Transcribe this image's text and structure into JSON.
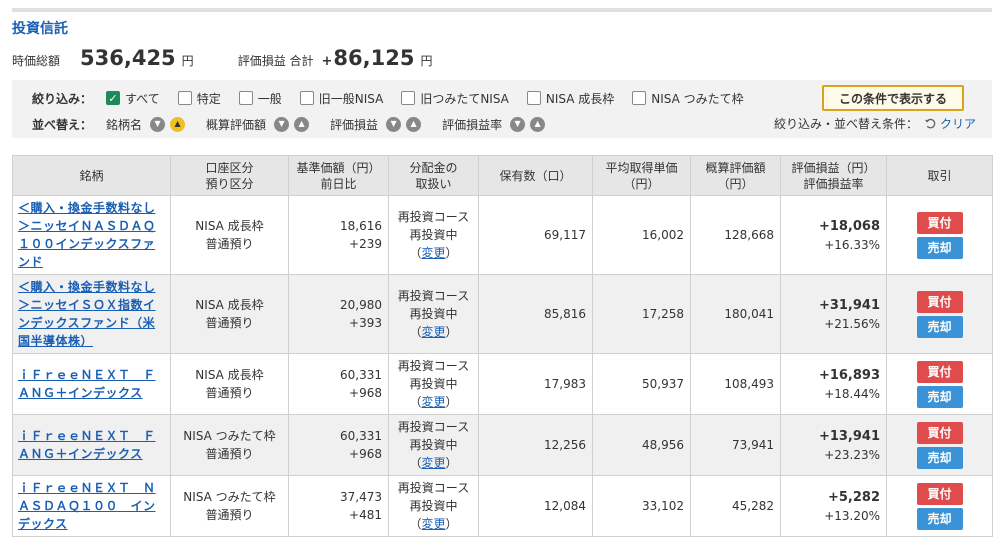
{
  "page": {
    "title": "投資信託"
  },
  "summary": {
    "market_value_label": "時価総額",
    "market_value": "536,425",
    "unit": "円",
    "pl_label": "評価損益 合計",
    "pl_sign": "+",
    "pl_value": "86,125"
  },
  "filter": {
    "label": "絞り込み：",
    "options": [
      {
        "label": "すべて",
        "checked": true
      },
      {
        "label": "特定",
        "checked": false
      },
      {
        "label": "一般",
        "checked": false
      },
      {
        "label": "旧一般NISA",
        "checked": false
      },
      {
        "label": "旧つみたてNISA",
        "checked": false
      },
      {
        "label": "NISA 成長枠",
        "checked": false
      },
      {
        "label": "NISA つみたて枠",
        "checked": false
      }
    ],
    "apply_label": "この条件で表示する"
  },
  "sort": {
    "label": "並べ替え：",
    "items": [
      "銘柄名",
      "概算評価額",
      "評価損益",
      "評価損益率"
    ],
    "condition_label": "絞り込み・並べ替え条件：",
    "clear_label": "クリア"
  },
  "table": {
    "headers": {
      "name": "銘柄",
      "account": [
        "口座区分",
        "預り区分"
      ],
      "nav": [
        "基準価額（円）",
        "前日比"
      ],
      "dist": [
        "分配金の",
        "取扱い"
      ],
      "qty": "保有数（口）",
      "avg": [
        "平均取得単価",
        "（円）"
      ],
      "val": [
        "概算評価額",
        "（円）"
      ],
      "pl": [
        "評価損益（円）",
        "評価損益率"
      ],
      "trade": "取引"
    },
    "rows": [
      {
        "name": "＜購入・換金手数料なし＞ニッセイＮＡＳＤＡＱ１００インデックスファンド",
        "account": "NISA 成長枠",
        "custody": "普通預り",
        "nav": "18,616",
        "change": "+239",
        "dist": "再投資コース",
        "dist_status": "再投資中",
        "change_link": "変更",
        "qty": "69,117",
        "avg": "16,002",
        "val": "128,668",
        "pl": "+18,068",
        "pl_rate": "+16.33%",
        "buy": "買付",
        "sell": "売却"
      },
      {
        "name": "＜購入・換金手数料なし＞ニッセイＳＯＸ指数インデックスファンド（米国半導体株）",
        "account": "NISA 成長枠",
        "custody": "普通預り",
        "nav": "20,980",
        "change": "+393",
        "dist": "再投資コース",
        "dist_status": "再投資中",
        "change_link": "変更",
        "qty": "85,816",
        "avg": "17,258",
        "val": "180,041",
        "pl": "+31,941",
        "pl_rate": "+21.56%",
        "buy": "買付",
        "sell": "売却"
      },
      {
        "name": "ｉＦｒｅｅＮＥＸＴ　ＦＡＮＧ＋インデックス",
        "account": "NISA 成長枠",
        "custody": "普通預り",
        "nav": "60,331",
        "change": "+968",
        "dist": "再投資コース",
        "dist_status": "再投資中",
        "change_link": "変更",
        "qty": "17,983",
        "avg": "50,937",
        "val": "108,493",
        "pl": "+16,893",
        "pl_rate": "+18.44%",
        "buy": "買付",
        "sell": "売却"
      },
      {
        "name": "ｉＦｒｅｅＮＥＸＴ　ＦＡＮＧ＋インデックス",
        "account": "NISA つみたて枠",
        "custody": "普通預り",
        "nav": "60,331",
        "change": "+968",
        "dist": "再投資コース",
        "dist_status": "再投資中",
        "change_link": "変更",
        "qty": "12,256",
        "avg": "48,956",
        "val": "73,941",
        "pl": "+13,941",
        "pl_rate": "+23.23%",
        "buy": "買付",
        "sell": "売却"
      },
      {
        "name": "ｉＦｒｅｅＮＥＸＴ　ＮＡＳＤＡＱ１００　インデックス",
        "account": "NISA つみたて枠",
        "custody": "普通預り",
        "nav": "37,473",
        "change": "+481",
        "dist": "再投資コース",
        "dist_status": "再投資中",
        "change_link": "変更",
        "qty": "12,084",
        "avg": "33,102",
        "val": "45,282",
        "pl": "+5,282",
        "pl_rate": "+13.20%",
        "buy": "買付",
        "sell": "売却"
      }
    ]
  }
}
